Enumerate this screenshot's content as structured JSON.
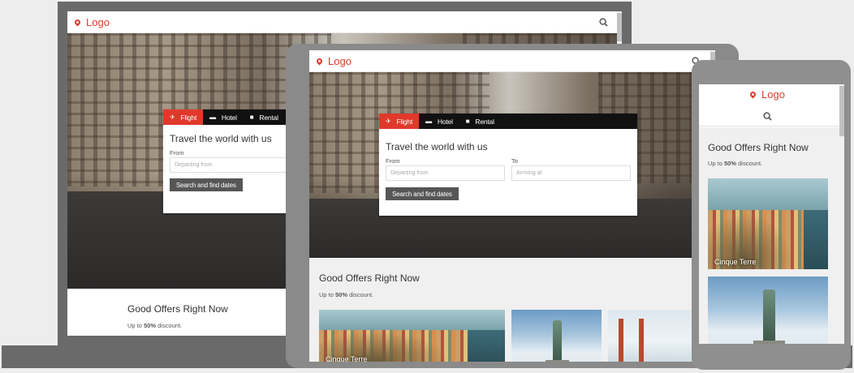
{
  "site": {
    "logo_text": "Logo",
    "brand_color": "#e0392b",
    "icons": {
      "logo": "map-pin-icon",
      "search": "search-icon",
      "flight": "plane-icon",
      "hotel": "bed-icon",
      "rental": "car-icon"
    }
  },
  "search_widget": {
    "tabs": [
      {
        "label": "Flight",
        "active": true
      },
      {
        "label": "Hotel",
        "active": false
      },
      {
        "label": "Rental",
        "active": false
      }
    ],
    "title": "Travel the world with us",
    "from_label": "From",
    "from_placeholder": "Departing from",
    "to_label": "To",
    "to_placeholder": "Arriving at",
    "submit_label": "Search and find dates"
  },
  "offers": {
    "title": "Good Offers Right Now",
    "subtitle_prefix": "Up to ",
    "subtitle_value": "50%",
    "subtitle_suffix": " discount.",
    "cards": [
      {
        "label": "Cinque Terre"
      },
      {
        "label": ""
      },
      {
        "label": ""
      }
    ]
  }
}
